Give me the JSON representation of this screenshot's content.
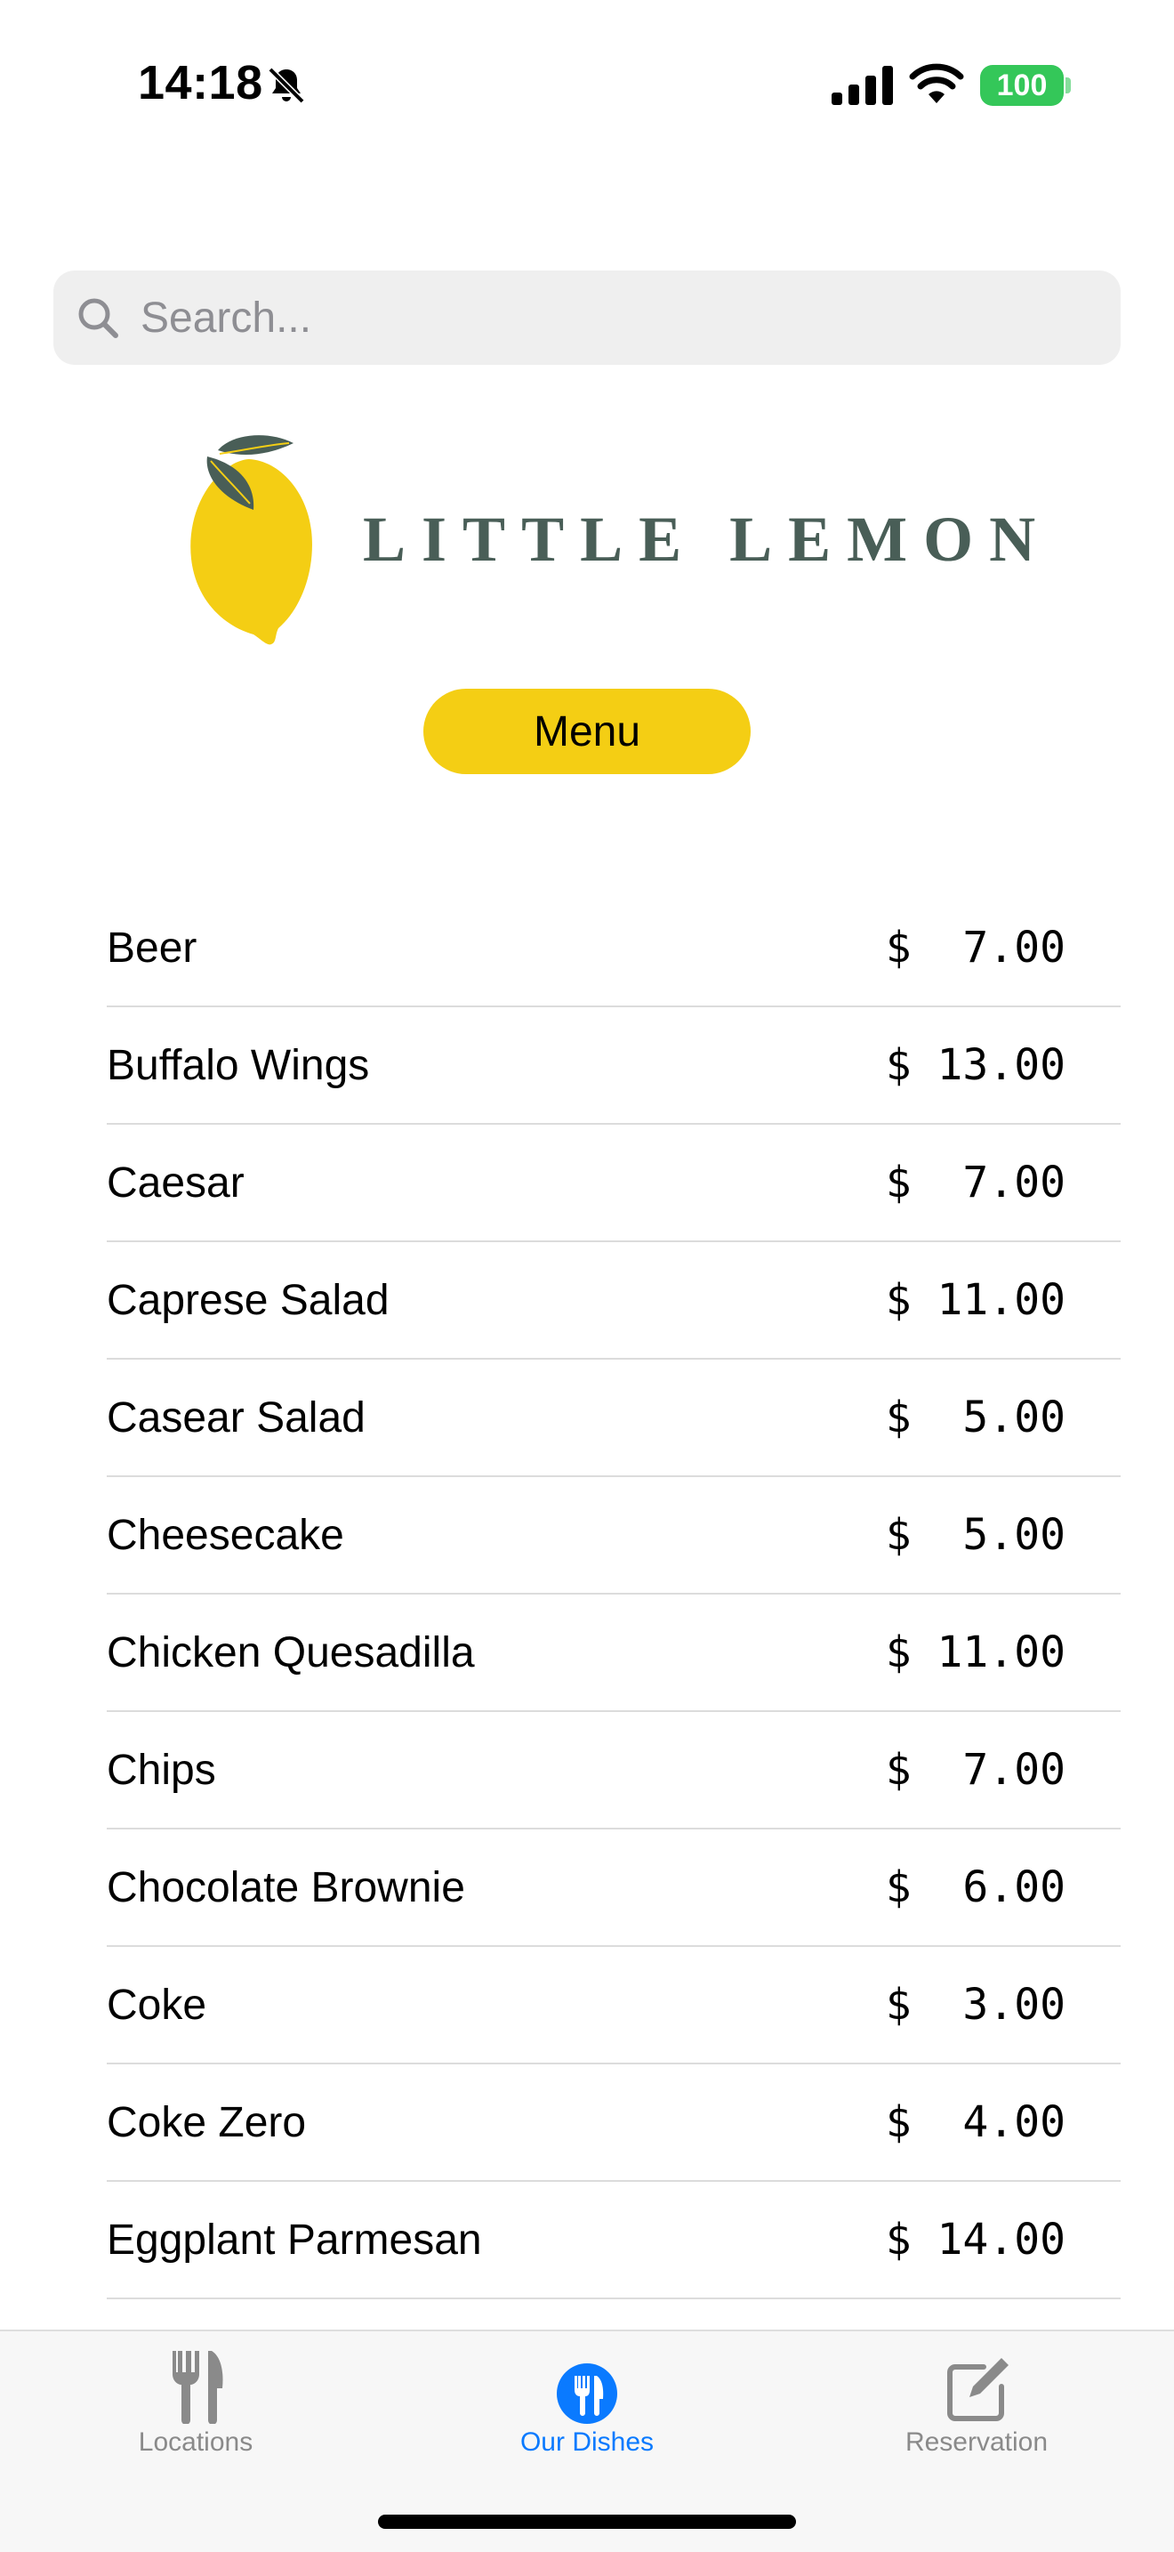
{
  "status_bar": {
    "time": "14:18",
    "battery": "100",
    "icons": [
      "bell-slash-icon",
      "cellular-signal-icon",
      "wifi-icon",
      "battery-icon"
    ],
    "battery_color": "#34c759"
  },
  "search": {
    "placeholder": "Search...",
    "icon": "magnifying-glass-icon"
  },
  "brand": {
    "name": "LITTLE LEMON",
    "lemon_color": "#f4ce14",
    "leaf_color": "#495e57",
    "text_color": "#495e57"
  },
  "menu_button": {
    "label": "Menu",
    "color": "#f4ce14"
  },
  "dishes": [
    {
      "name": "Beer",
      "price": "$  7.00"
    },
    {
      "name": "Buffalo Wings",
      "price": "$ 13.00"
    },
    {
      "name": "Caesar",
      "price": "$  7.00"
    },
    {
      "name": "Caprese Salad",
      "price": "$ 11.00"
    },
    {
      "name": "Casear Salad",
      "price": "$  5.00"
    },
    {
      "name": "Cheesecake",
      "price": "$  5.00"
    },
    {
      "name": "Chicken Quesadilla",
      "price": "$ 11.00"
    },
    {
      "name": "Chips",
      "price": "$  7.00"
    },
    {
      "name": "Chocolate Brownie",
      "price": "$  6.00"
    },
    {
      "name": "Coke",
      "price": "$  3.00"
    },
    {
      "name": "Coke Zero",
      "price": "$  4.00"
    },
    {
      "name": "Eggplant Parmesan",
      "price": "$ 14.00"
    }
  ],
  "tab_bar": {
    "tabs": [
      {
        "label": "Locations",
        "icon": "fork-knife-icon",
        "active": false
      },
      {
        "label": "Our Dishes",
        "icon": "fork-knife-circle-icon",
        "active": true
      },
      {
        "label": "Reservation",
        "icon": "square-pencil-icon",
        "active": false
      }
    ],
    "active_color": "#0a7aff",
    "inactive_color": "#8a8a8a"
  }
}
